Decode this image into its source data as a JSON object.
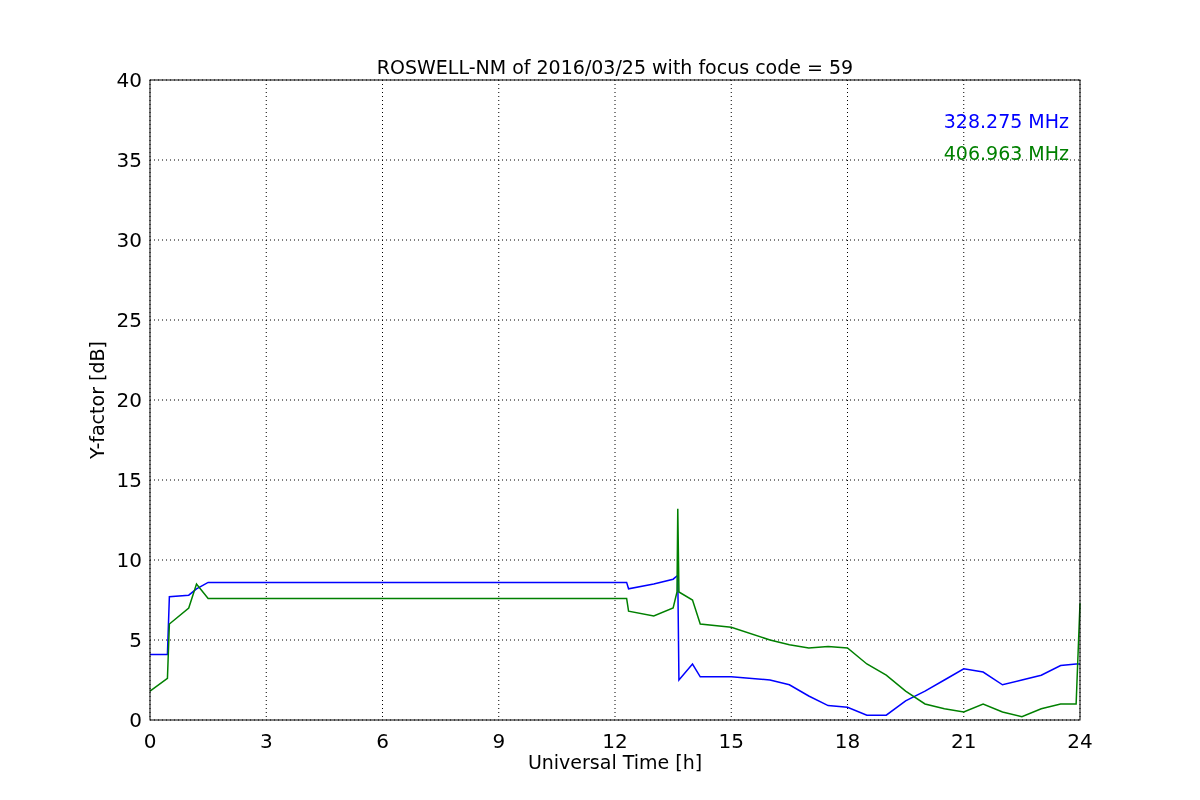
{
  "chart_data": {
    "type": "line",
    "title": "ROSWELL-NM of 2016/03/25 with focus code = 59",
    "xlabel": "Universal Time [h]",
    "ylabel": "Y-factor [dB]",
    "x": [
      0,
      0.45,
      0.5,
      1.0,
      1.2,
      1.5,
      12.3,
      12.35,
      13,
      13.5,
      13.6,
      13.62,
      13.65,
      14,
      14.2,
      15,
      16,
      16.5,
      17,
      17.5,
      18,
      18.5,
      19,
      19.5,
      20,
      20.5,
      21,
      21.5,
      22,
      22.5,
      23,
      23.5,
      23.9,
      24
    ],
    "series": [
      {
        "name": "328.275 MHz",
        "color": "#0000ff",
        "values": [
          4.1,
          4.1,
          7.7,
          7.8,
          8.2,
          8.6,
          8.6,
          8.2,
          8.5,
          8.8,
          9.0,
          9.0,
          2.5,
          3.5,
          2.7,
          2.7,
          2.5,
          2.2,
          1.5,
          0.9,
          0.8,
          0.3,
          0.3,
          1.2,
          1.8,
          2.5,
          3.2,
          3.0,
          2.2,
          2.5,
          2.8,
          3.4,
          3.5,
          3.5
        ]
      },
      {
        "name": "406.963 MHz",
        "color": "#008000",
        "values": [
          1.8,
          2.6,
          6.0,
          7.0,
          8.5,
          7.6,
          7.6,
          6.8,
          6.5,
          7.0,
          8.0,
          13.2,
          8.0,
          7.5,
          6.0,
          5.8,
          5.0,
          4.7,
          4.5,
          4.6,
          4.5,
          3.5,
          2.8,
          1.8,
          1.0,
          0.7,
          0.5,
          1.0,
          0.5,
          0.2,
          0.7,
          1.0,
          1.0,
          7.3
        ]
      }
    ],
    "grid": true,
    "xlim": [
      0,
      24
    ],
    "ylim": [
      0,
      40
    ],
    "xticks": [
      0,
      3,
      6,
      9,
      12,
      15,
      18,
      21,
      24
    ],
    "yticks": [
      0,
      5,
      10,
      15,
      20,
      25,
      30,
      35,
      40
    ]
  }
}
